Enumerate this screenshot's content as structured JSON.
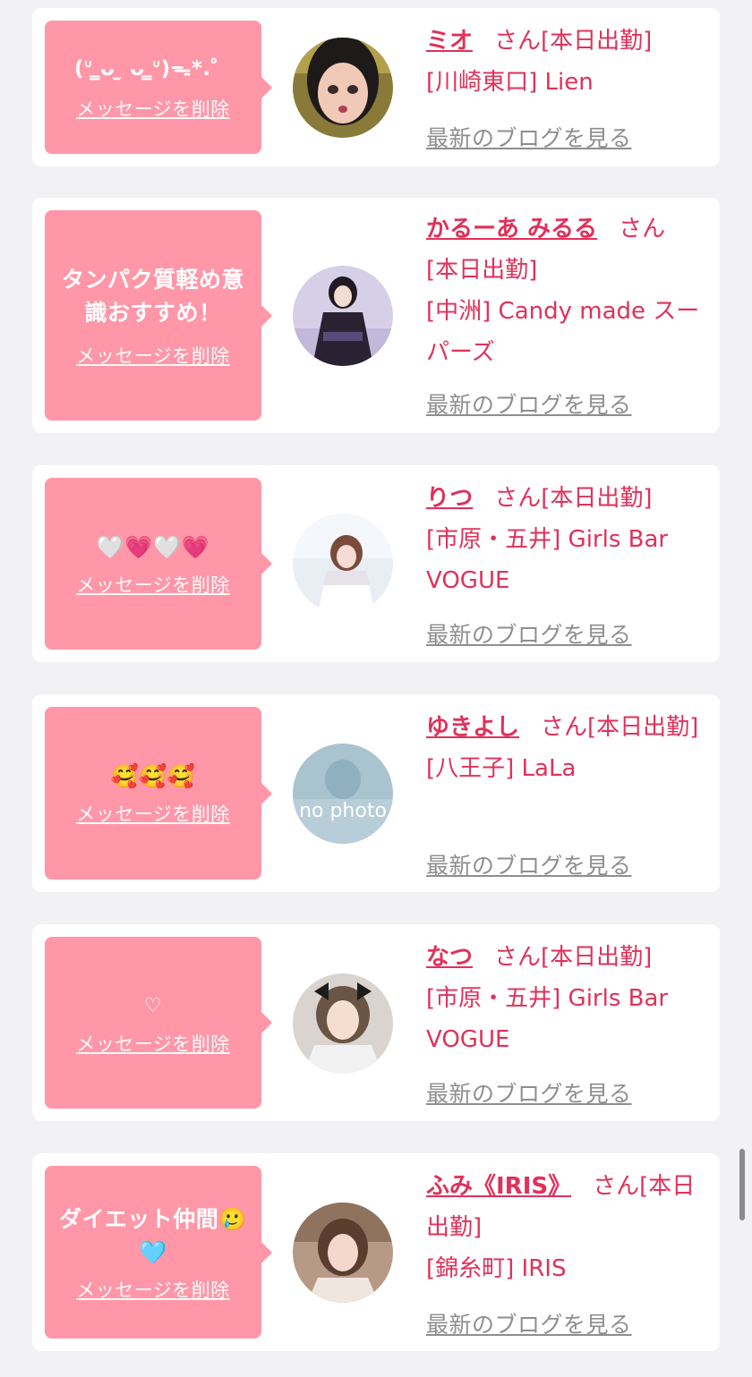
{
  "common": {
    "delete_label": "メッセージを削除",
    "blog_label": "最新のブログを見る",
    "san_label": "さん"
  },
  "cards": [
    {
      "message": "(ᐡ ̳ᴗ ̫ ᴗ ̳ᐡ)ᯓ*.゜",
      "name": "ミオ",
      "status": "[本日出勤]",
      "shop": "[川崎東口] Lien"
    },
    {
      "message": "タンパク質軽め意識おすすめ！",
      "name": "かるーあ みるる",
      "status": "[本日出勤]",
      "shop": "[中洲] Candy made スーパーズ"
    },
    {
      "message": "🤍💗🤍💗",
      "name": "りつ",
      "status": "[本日出勤]",
      "shop": "[市原・五井] Girls Bar VOGUE"
    },
    {
      "message": "🥰🥰🥰",
      "name": "ゆきよし",
      "status": "[本日出勤]",
      "shop": "[八王子] LaLa",
      "photo_text": "no photo"
    },
    {
      "message": "♡",
      "name": "なつ",
      "status": "[本日出勤]",
      "shop": "[市原・五井] Girls Bar VOGUE"
    },
    {
      "message": "ダイエット仲間🥲🩵",
      "name": "ふみ《IRIS》",
      "status": "[本日出勤]",
      "shop": "[錦糸町] IRIS"
    }
  ]
}
